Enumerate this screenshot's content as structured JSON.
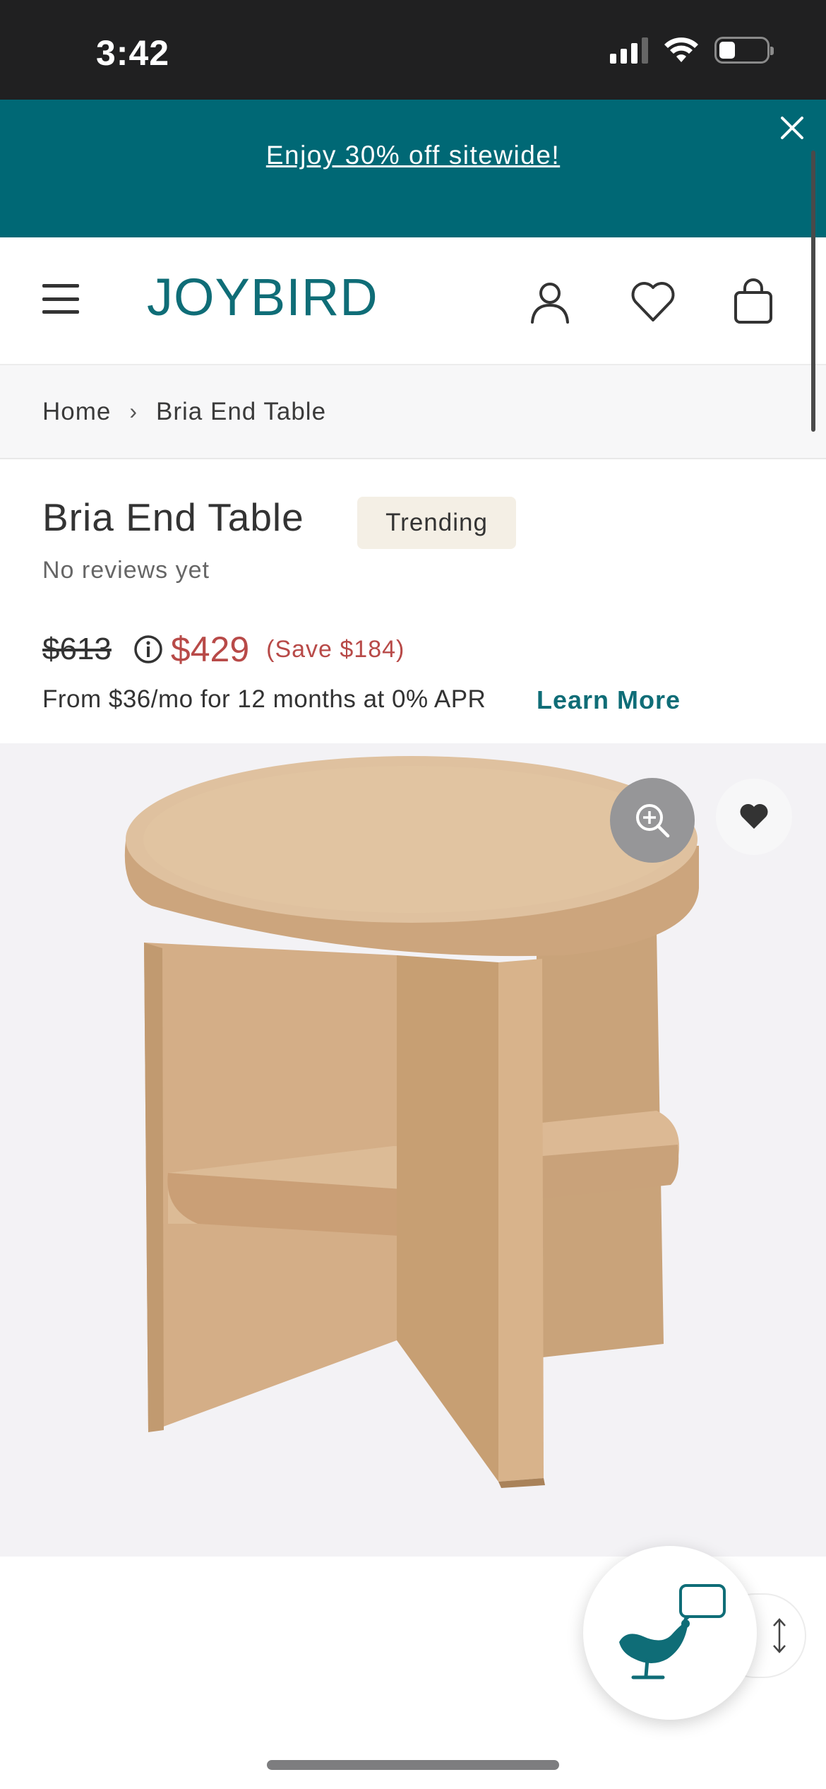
{
  "status_bar": {
    "time": "3:42"
  },
  "promo": {
    "text": "Enjoy 30% off sitewide!",
    "close_icon": "close-icon"
  },
  "header": {
    "logo": "JOYBIRD",
    "icons": [
      "menu-icon",
      "account-icon",
      "heart-icon",
      "bag-icon"
    ]
  },
  "breadcrumb": {
    "home": "Home",
    "separator": "›",
    "current": "Bria End Table"
  },
  "product": {
    "title": "Bria End Table",
    "badge": "Trending",
    "reviews": "No reviews yet",
    "old_price": "$613",
    "new_price": "$429",
    "save_text": "(Save $184)",
    "financing": "From $36/mo for 12 months at 0% APR",
    "learn_more": "Learn More"
  },
  "colors": {
    "brand_teal": "#006875",
    "logo_teal": "#0f6d77",
    "sale_red": "#b84a48",
    "badge_bg": "#f4efe5",
    "image_bg": "#f3f2f5"
  }
}
